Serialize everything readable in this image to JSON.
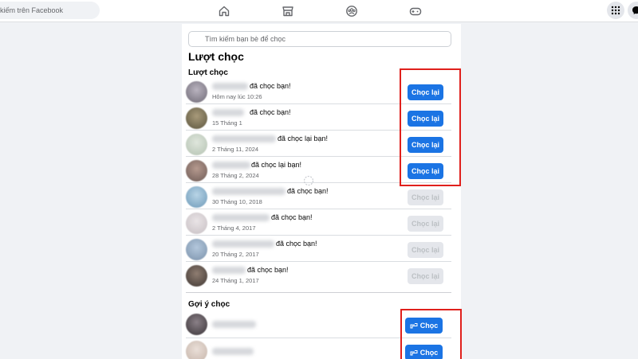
{
  "header": {
    "search_placeholder": "kiếm trên Facebook",
    "nav_icons": [
      "home-icon",
      "marketplace-icon",
      "groups-icon",
      "gaming-icon"
    ],
    "right_icons": [
      "menu-grid-icon",
      "messenger-icon"
    ]
  },
  "panel": {
    "friend_search_placeholder": "Tìm kiếm bạn bè để chọc",
    "title": "Lượt chọc",
    "pokes_heading": "Lượt chọc",
    "suggestions_heading": "Gợi ý chọc",
    "pokes": [
      {
        "message": "đã chọc bạn!",
        "time": "Hôm nay lúc 10:26",
        "button": "Chọc lại",
        "enabled": true
      },
      {
        "message": "đã chọc bạn!",
        "time": "15 Tháng 1",
        "button": "Chọc lại",
        "enabled": true
      },
      {
        "message": "đã chọc lại bạn!",
        "time": "2 Tháng 11, 2024",
        "button": "Chọc lại",
        "enabled": true
      },
      {
        "message": "đã chọc lại bạn!",
        "time": "28 Tháng 2, 2024",
        "button": "Chọc lại",
        "enabled": true
      },
      {
        "message": "đã chọc bạn!",
        "time": "30 Tháng 10, 2018",
        "button": "Chọc lại",
        "enabled": false
      },
      {
        "message": "đã chọc bạn!",
        "time": "2 Tháng 4, 2017",
        "button": "Chọc lại",
        "enabled": false
      },
      {
        "message": "đã chọc bạn!",
        "time": "20 Tháng 2, 2017",
        "button": "Chọc lại",
        "enabled": false
      },
      {
        "message": "đã chọc bạn!",
        "time": "24 Tháng 1, 2017",
        "button": "Chọc lại",
        "enabled": false
      }
    ],
    "suggestions": [
      {
        "button": "Chọc"
      },
      {
        "button": "Chọc"
      }
    ]
  },
  "colors": {
    "accent": "#1b74e4",
    "highlight_box": "#e0201c",
    "disabled_button": "#e4e6eb"
  }
}
